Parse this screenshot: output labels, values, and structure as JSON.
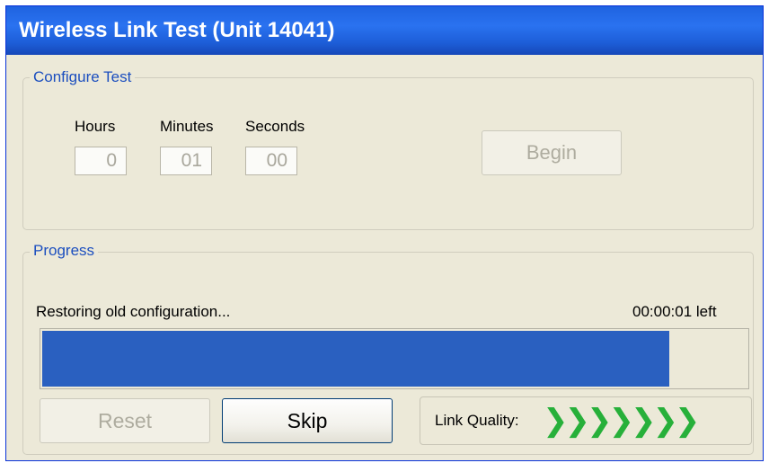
{
  "window": {
    "title": "Wireless Link Test (Unit 14041)"
  },
  "configure": {
    "group_label": "Configure Test",
    "hours_label": "Hours",
    "minutes_label": "Minutes",
    "seconds_label": "Seconds",
    "hours_value": "0",
    "minutes_value": "01",
    "seconds_value": "00",
    "begin_label": "Begin"
  },
  "progress": {
    "group_label": "Progress",
    "status_text": "Restoring old configuration...",
    "time_left": "00:00:01 left",
    "percent": 89,
    "reset_label": "Reset",
    "skip_label": "Skip",
    "link_quality_label": "Link Quality:",
    "link_quality_arrows": "❯❯❯❯❯❯❯"
  },
  "colors": {
    "progress_fill": "#2a60c0",
    "link_quality": "#27b03a",
    "title_bar": "#1f63e0"
  }
}
